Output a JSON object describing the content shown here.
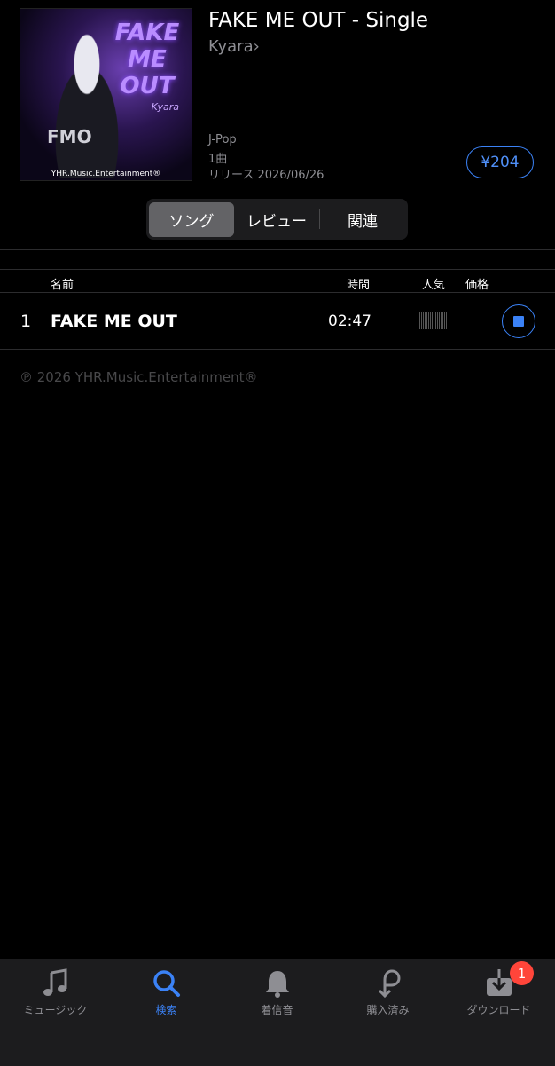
{
  "album": {
    "title": "FAKE ME OUT - Single",
    "artist": "Kyara",
    "artist_chevron": "›",
    "genre": "J-Pop",
    "track_count": "1曲",
    "release": "リリース 2026/06/26",
    "price": "¥204",
    "artwork": {
      "title_text": "FAKE ME OUT",
      "artist_text": "Kyara",
      "fmo_text": "FMO",
      "label_text": "YHR.Music.Entertainment®"
    }
  },
  "segments": [
    {
      "label": "ソング",
      "active": true
    },
    {
      "label": "レビュー",
      "active": false
    },
    {
      "label": "関連",
      "active": false
    }
  ],
  "columns": {
    "name": "名前",
    "time": "時間",
    "popularity": "人気",
    "price": "価格"
  },
  "tracks": [
    {
      "number": "1",
      "title": "FAKE ME OUT",
      "duration": "02:47"
    }
  ],
  "copyright": "℗ 2026 YHR.Music.Entertainment®",
  "tabbar": {
    "items": [
      {
        "label": "ミュージック",
        "icon": "music-note-icon"
      },
      {
        "label": "検索",
        "icon": "search-icon",
        "active": true
      },
      {
        "label": "着信音",
        "icon": "bell-icon"
      },
      {
        "label": "購入済み",
        "icon": "purchased-icon"
      },
      {
        "label": "ダウンロード",
        "icon": "download-icon"
      }
    ],
    "download_badge": "1"
  },
  "colors": {
    "accent": "#3b82f6",
    "background": "#000000",
    "tabbar": "#1c1c1e",
    "badge": "#ff453a"
  }
}
